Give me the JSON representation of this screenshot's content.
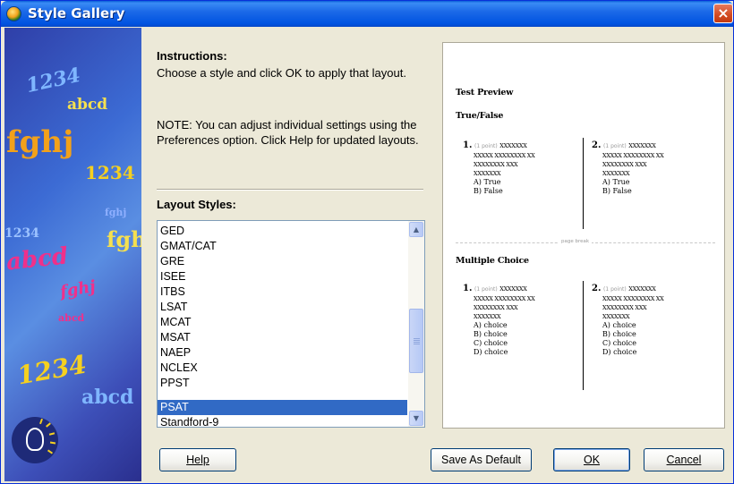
{
  "window": {
    "title": "Style Gallery",
    "close_label": "×"
  },
  "banner": {
    "glyphs": [
      "1234",
      "abcd",
      "fghj",
      "1234",
      "fghj",
      "1234",
      "abcd",
      "fgh",
      "fghj",
      "abcd",
      "1234",
      "abcd"
    ]
  },
  "instructions": {
    "title": "Instructions:",
    "text": "Choose a style and click OK to apply that layout.",
    "note": "NOTE: You can adjust individual settings using the Preferences option.  Click Help for updated layouts."
  },
  "layout_styles": {
    "label": "Layout Styles:",
    "items": [
      "GED",
      "GMAT/CAT",
      "GRE",
      "ISEE",
      "ITBS",
      "LSAT",
      "MCAT",
      "MSAT",
      "NAEP",
      "NCLEX",
      "PPST",
      "PSAT",
      "Standford-9"
    ],
    "selected": "PSAT"
  },
  "preview": {
    "title": "Test Preview",
    "section1": "True/False",
    "section2": "Multiple Choice",
    "page_break": "page break",
    "points": "(1 point)",
    "placeholder": [
      "XXXXXXX",
      "XXXXX XXXXXXXX XX",
      "XXXXXXXX XXX",
      "XXXXXXX"
    ],
    "tf_items": [
      {
        "num": "1.",
        "options": [
          "A) True",
          "B) False"
        ]
      },
      {
        "num": "2.",
        "options": [
          "A) True",
          "B) False"
        ]
      }
    ],
    "mc_items": [
      {
        "num": "1.",
        "options": [
          "A) choice",
          "B) choice",
          "C) choice",
          "D) choice"
        ]
      },
      {
        "num": "2.",
        "options": [
          "A) choice",
          "B) choice",
          "C) choice",
          "D) choice"
        ]
      }
    ]
  },
  "buttons": {
    "help": "Help",
    "save_default": "Save As Default",
    "ok": "OK",
    "cancel": "Cancel"
  },
  "colors": {
    "title_bar": "#0053e1",
    "selection": "#316ac5",
    "dialog_bg": "#ece9d8"
  }
}
